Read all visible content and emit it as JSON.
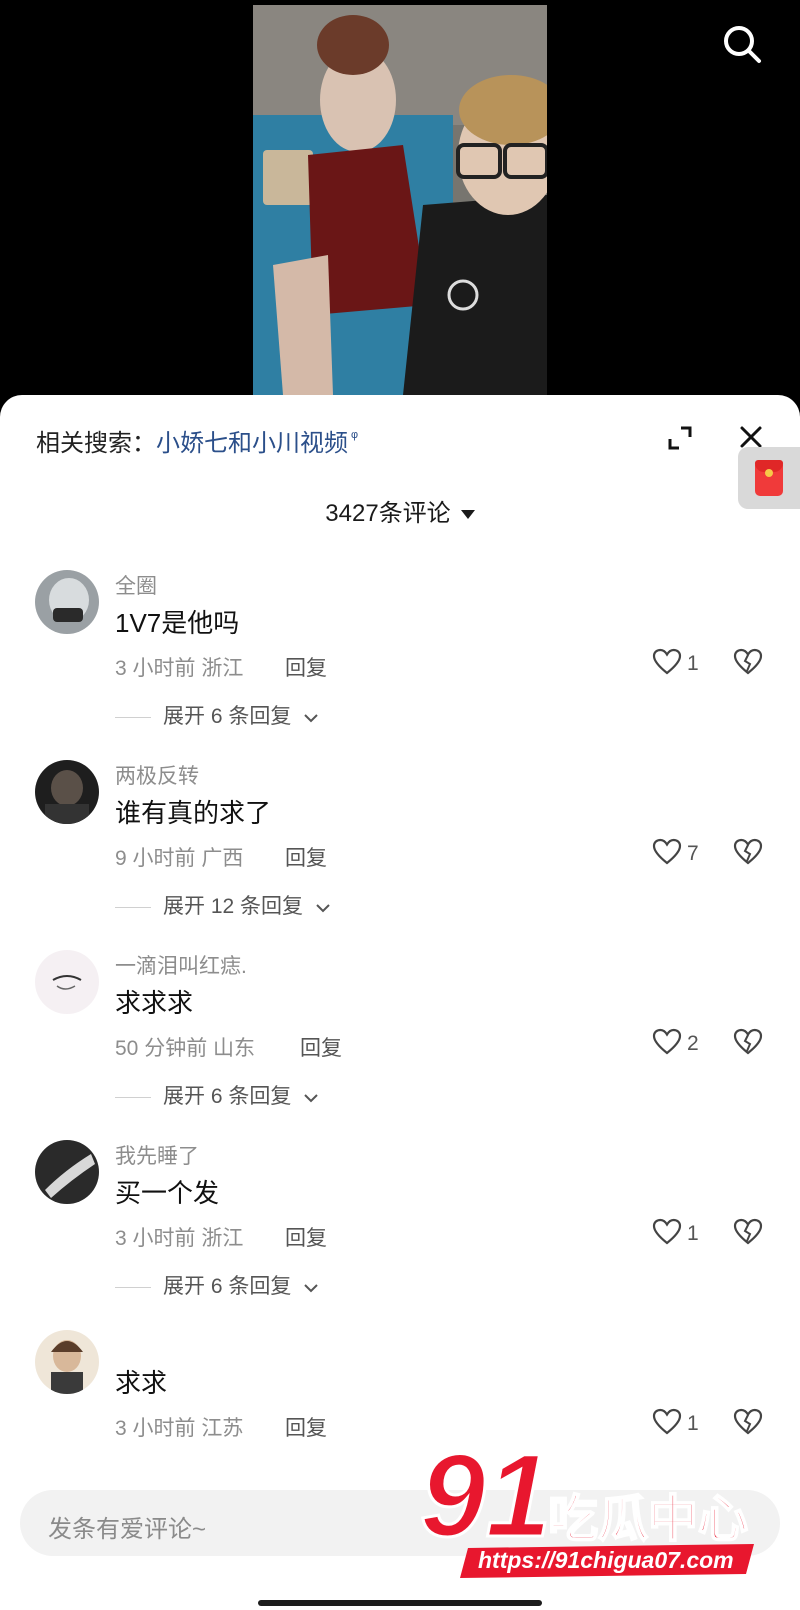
{
  "related": {
    "label": "相关搜索：",
    "term": "小娇七和小川视频",
    "glyph": "ᵠ"
  },
  "comment_count": "3427条评论",
  "comments": [
    {
      "user": "全圈",
      "text": "1V7是他吗",
      "meta": "3 小时前 浙江",
      "reply": "回复",
      "likes": "1",
      "expand": "展开 6 条回复"
    },
    {
      "user": "两极反转",
      "text": "谁有真的求了",
      "meta": "9 小时前 广西",
      "reply": "回复",
      "likes": "7",
      "expand": "展开 12 条回复"
    },
    {
      "user": "一滴泪叫红痣.",
      "text": "求求求",
      "meta": "50 分钟前 山东",
      "reply": "回复",
      "likes": "2",
      "expand": "展开 6 条回复"
    },
    {
      "user": "我先睡了",
      "text": "买一个发",
      "meta": "3 小时前 浙江",
      "reply": "回复",
      "likes": "1",
      "expand": "展开 6 条回复"
    },
    {
      "user": "",
      "text": "求求",
      "meta": "3 小时前 江苏",
      "reply": "回复",
      "likes": "1",
      "expand": ""
    }
  ],
  "input": {
    "placeholder": "发条有爱评论~"
  },
  "watermark": {
    "number": "91",
    "name": "吃瓜中心",
    "url": "https://91chigua07.com"
  },
  "icons": [
    "search-icon",
    "expand-icon",
    "close-icon",
    "red-packet-icon",
    "heart-icon",
    "broken-heart-icon",
    "chevron-down-icon"
  ],
  "colors": {
    "accent_link": "#2b4f8a",
    "watermark_red": "#e8172e"
  }
}
